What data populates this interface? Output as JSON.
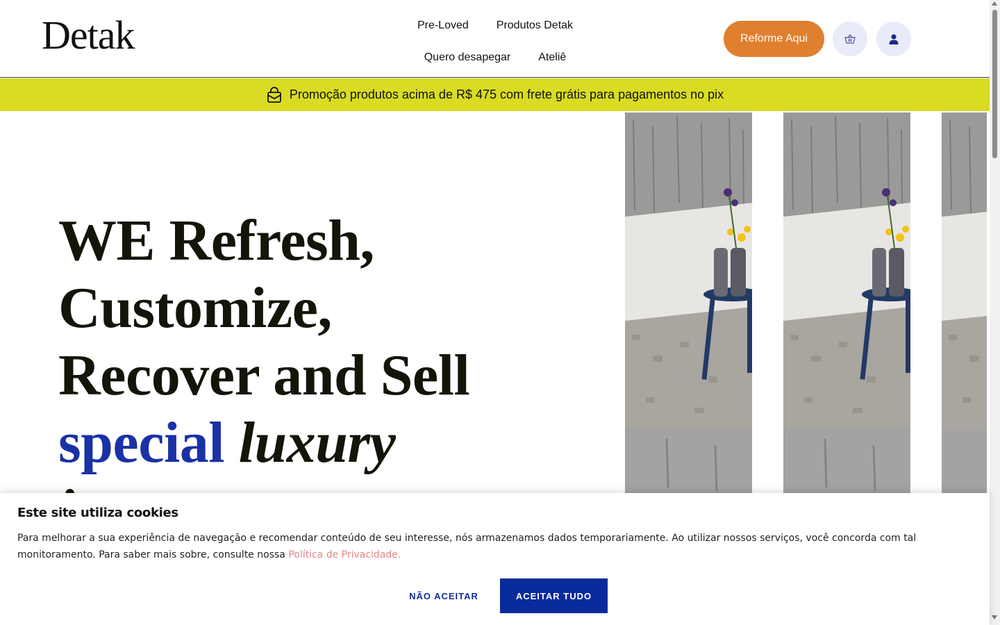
{
  "header": {
    "logo": "Detak",
    "nav": [
      "Pre-Loved",
      "Produtos Detak",
      "Quero desapegar",
      "Ateliê"
    ],
    "cta_label": "Reforme Aqui",
    "cart_icon": "basket-icon",
    "user_icon": "user-icon"
  },
  "promo": {
    "icon": "shopping-bag-icon",
    "text": "Promoção produtos acima de R$ 475 com frete grátis para pagamentos no pix"
  },
  "hero": {
    "line1_bold": "WE",
    "line1_rest": "Refresh,",
    "line2": "Customize,",
    "line3": "Recover and Sell",
    "line4_blue": "special",
    "line4_bold_italic": "luxury",
    "line5_partial": "i"
  },
  "cookie": {
    "title": "Este site utiliza cookies",
    "body": "Para melhorar a sua experiência de navegação e recomendar conteúdo de seu interesse, nós armazenamos dados temporariamente. Ao utilizar nossos serviços, você concorda com tal monitoramento. Para saber mais sobre, consulte nossa ",
    "link": "Política de Privacidade.",
    "reject_label": "NÃO ACEITAR",
    "accept_label": "ACEITAR TUDO"
  },
  "colors": {
    "accent_orange": "#e07f2e",
    "promo_yellow": "#d9dc22",
    "brand_blue": "#0a2b9c",
    "link_pink": "#e58585"
  }
}
